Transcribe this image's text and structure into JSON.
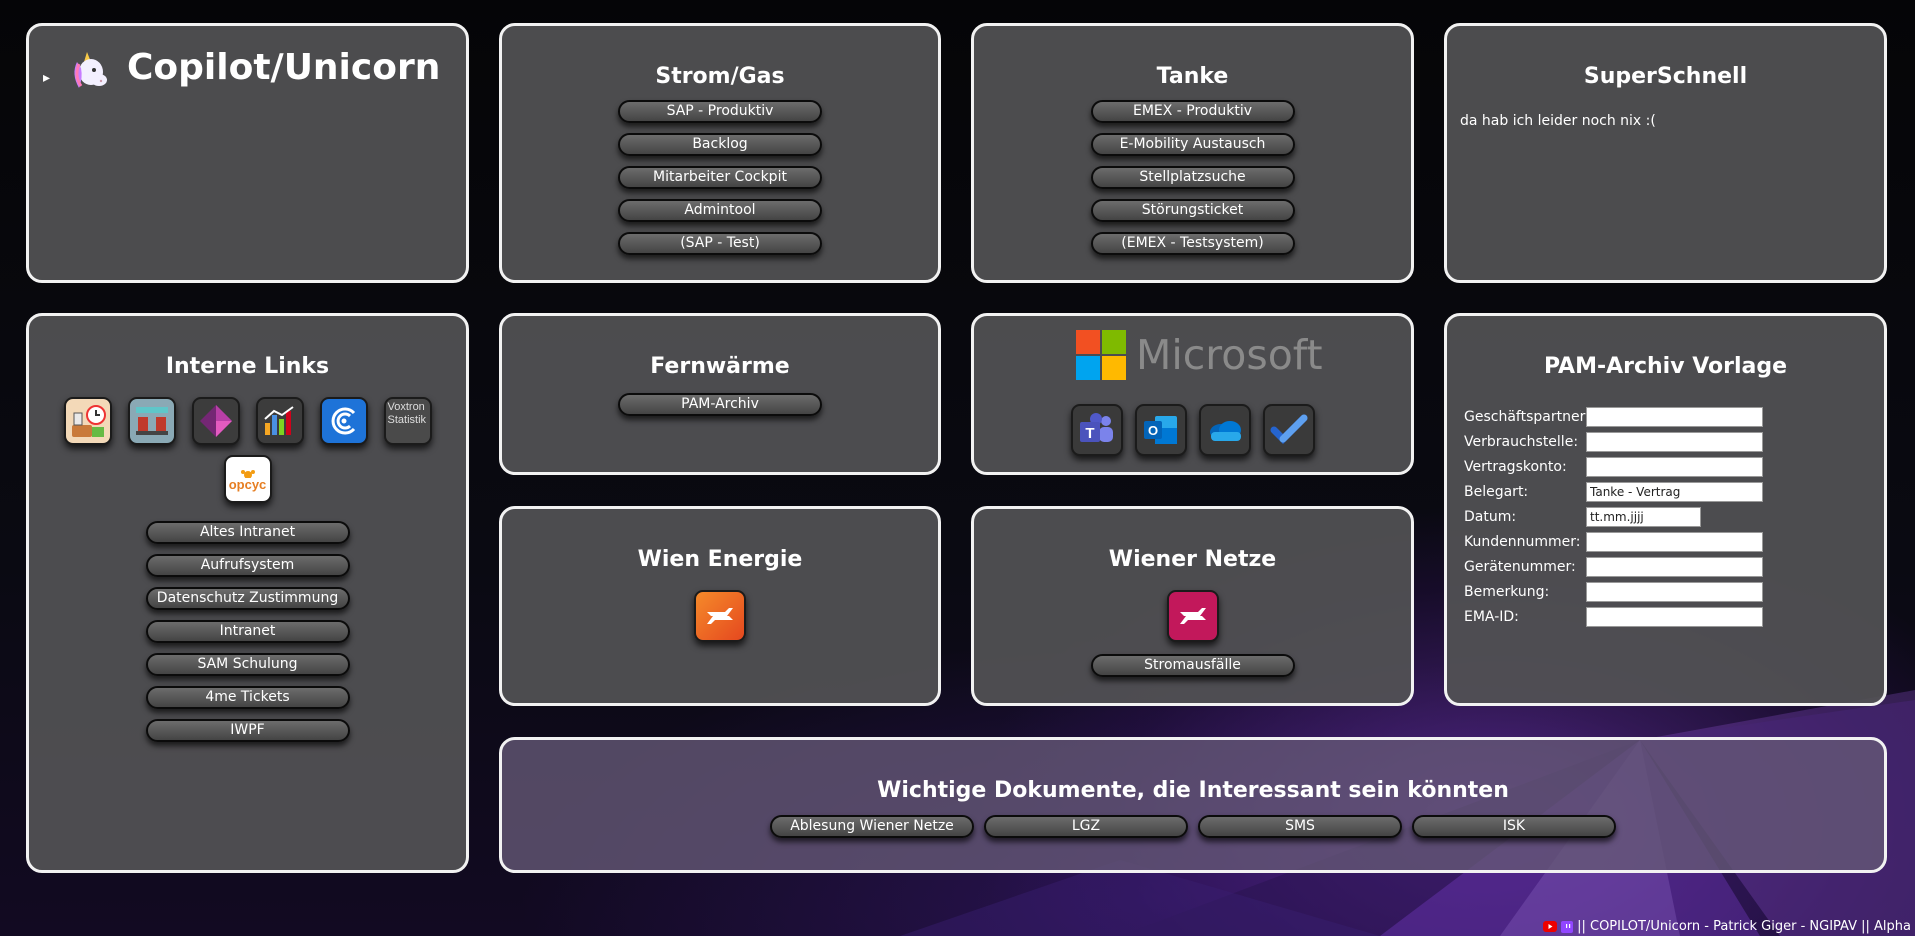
{
  "brand": {
    "title": "Copilot/Unicorn",
    "expander": "▸",
    "icon": "unicorn-icon"
  },
  "strom_gas": {
    "title": "Strom/Gas",
    "buttons": [
      "SAP - Produktiv",
      "Backlog",
      "Mitarbeiter Cockpit",
      "Admintool",
      "(SAP - Test)"
    ]
  },
  "tanke": {
    "title": "Tanke",
    "buttons": [
      "EMEX - Produktiv",
      "E-Mobility Austausch",
      "Stellplatzsuche",
      "Störungsticket",
      "(EMEX - Testsystem)"
    ]
  },
  "superschnell": {
    "title": "SuperSchnell",
    "text": "da hab ich leider noch nix :("
  },
  "interne_links": {
    "title": "Interne Links",
    "icon_names": [
      "canteen-menu-icon",
      "seating-icon",
      "power-apps-icon",
      "statistics-icon",
      "sync-c-icon",
      "voxtron-icon",
      "opcyc-icon"
    ],
    "voxtron_alt": "Voxtron Statistik",
    "opcyc_label": "opcyc",
    "buttons": [
      "Altes Intranet",
      "Aufrufsystem",
      "Datenschutz Zustimmung",
      "Intranet",
      "SAM Schulung",
      "4me Tickets",
      "IWPF"
    ]
  },
  "fernwaerme": {
    "title": "Fernwärme",
    "buttons": [
      "PAM-Archiv"
    ]
  },
  "microsoft": {
    "logo_text": "Microsoft",
    "apps": [
      "teams-icon",
      "outlook-icon",
      "onedrive-icon",
      "todo-icon"
    ],
    "logo_colors": [
      "#f25022",
      "#7fba00",
      "#00a4ef",
      "#ffb900"
    ]
  },
  "pam": {
    "title": "PAM-Archiv Vorlage",
    "fields": [
      {
        "label": "Geschäftspartner:",
        "value": ""
      },
      {
        "label": "Verbrauchstelle:",
        "value": ""
      },
      {
        "label": "Vertragskonto:",
        "value": ""
      },
      {
        "label": "Belegart:",
        "value": "Tanke - Vertrag"
      },
      {
        "label": "Datum:",
        "value": "tt.mm.jjjj"
      },
      {
        "label": "Kundennummer:",
        "value": ""
      },
      {
        "label": "Gerätenummer:",
        "value": ""
      },
      {
        "label": "Bemerkung:",
        "value": ""
      },
      {
        "label": "EMA-ID:",
        "value": ""
      }
    ]
  },
  "wien_energie": {
    "title": "Wien Energie",
    "icon": "wien-energie-logo-icon",
    "color": "#f06a1e"
  },
  "wiener_netze": {
    "title": "Wiener Netze",
    "icon": "wiener-netze-logo-icon",
    "color": "#c2185b",
    "buttons": [
      "Stromausfälle"
    ]
  },
  "dokumente": {
    "title": "Wichtige Dokumente, die Interessant sein könnten",
    "buttons": [
      "Ablesung Wiener Netze",
      "LGZ",
      "SMS",
      "ISK"
    ]
  },
  "footer": {
    "text": "|| COPILOT/Unicorn - Patrick Giger - NGIPAV || Alpha",
    "icons": [
      "youtube-icon",
      "twitch-icon"
    ]
  }
}
